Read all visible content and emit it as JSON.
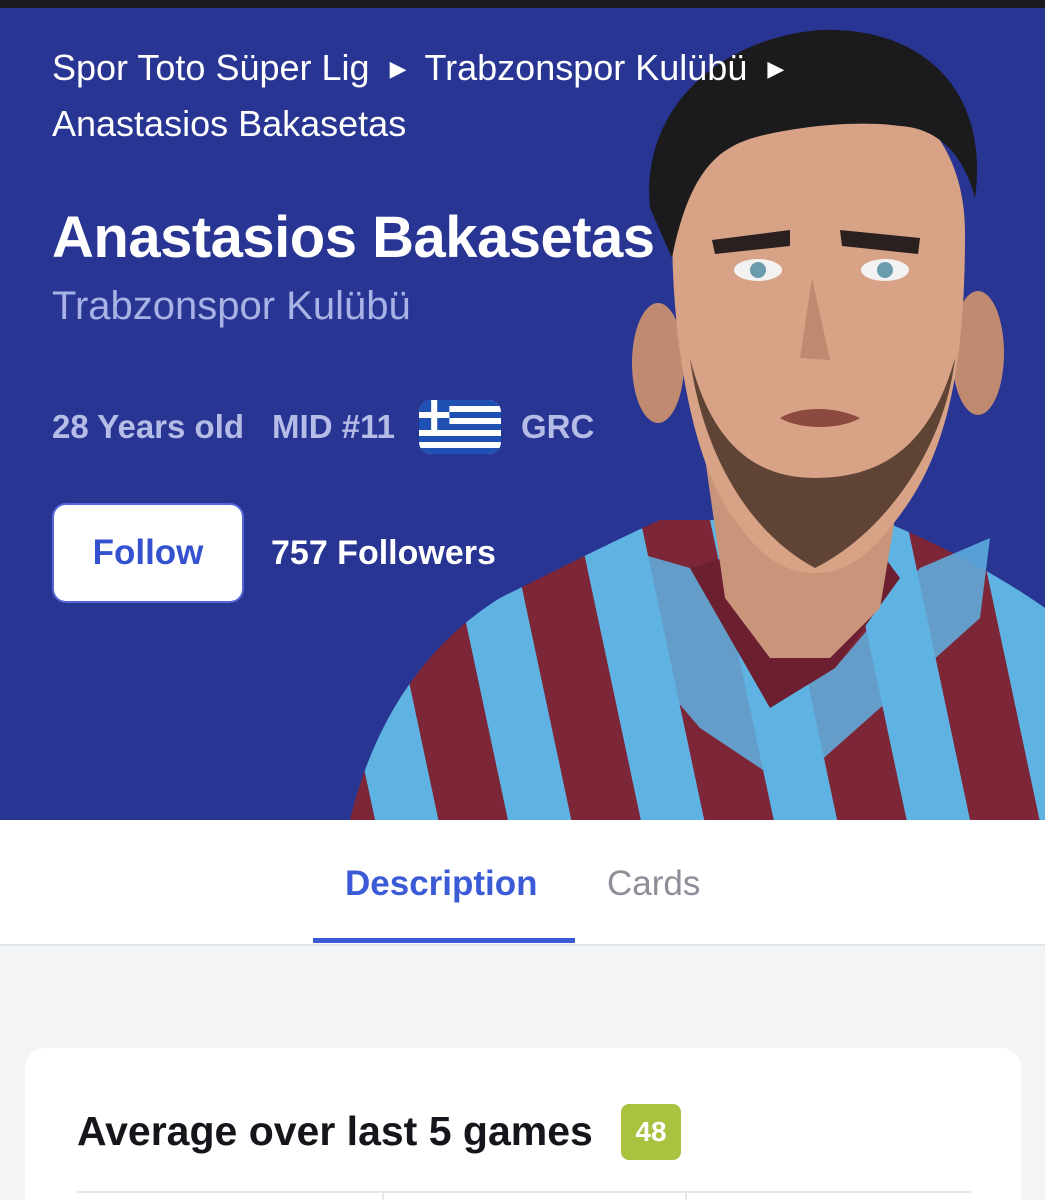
{
  "breadcrumb": {
    "items": [
      "Spor Toto Süper Lig",
      "Trabzonspor Kulübü",
      "Anastasios Bakasetas"
    ]
  },
  "player": {
    "name": "Anastasios Bakasetas",
    "club": "Trabzonspor Kulübü",
    "age": "28 Years old",
    "position": "MID #11",
    "nationality": "GRC",
    "flag_icon": "greece-flag-icon"
  },
  "follow": {
    "button_label": "Follow",
    "followers": "757 Followers"
  },
  "tabs": [
    {
      "label": "Description",
      "active": true
    },
    {
      "label": "Cards",
      "active": false
    }
  ],
  "stats": {
    "title": "Average over last 5 games",
    "score": "48"
  },
  "colors": {
    "hero_bg": "#283593",
    "accent": "#3b5bd6",
    "score_badge": "#a9c23f",
    "jersey_maroon": "#7d2638",
    "jersey_blue": "#5fb3e3"
  }
}
